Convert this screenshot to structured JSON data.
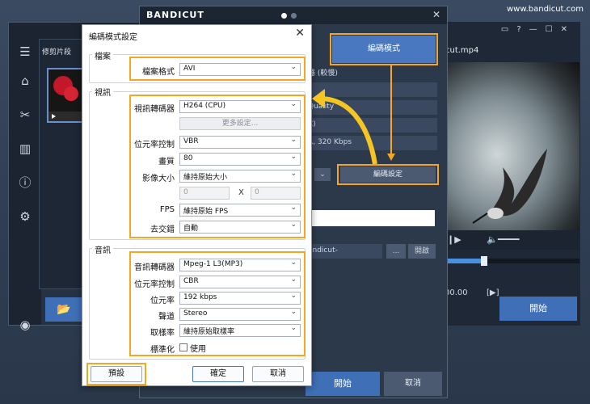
{
  "site": {
    "url": "www.bandicut.com"
  },
  "main_window": {
    "left_panel_header": "修剪片段",
    "open_icon": "folder-icon",
    "sidebar_icons": [
      "menu-icon",
      "home-icon",
      "cut-icon",
      "split-icon",
      "info-icon",
      "gear-icon",
      "record-icon"
    ]
  },
  "preview_window": {
    "filename": "cut.mp4",
    "time": "00.00",
    "frame_label": "[▶]",
    "start_label": "開始"
  },
  "encoding_window": {
    "logo": "BANDICUT",
    "encoding_mode_button": "編碼模式",
    "encoding_settings_button": "編碼設定",
    "rows": [
      "器 (較慢)",
      "Quality",
      "C)",
      "R, 320 Kbps"
    ],
    "output_text": "andicut-",
    "browse_label": "...",
    "open_label": "開啟",
    "start_label": "開始",
    "cancel_label": "取消"
  },
  "dialog": {
    "title": "編碼模式設定",
    "file_group": {
      "label": "檔案",
      "format_label": "檔案格式",
      "format_value": "AVI"
    },
    "video_group": {
      "label": "視訊",
      "codec_label": "視訊轉碼器",
      "codec_value": "H264 (CPU)",
      "more_settings": "更多設定...",
      "bitrate_label": "位元率控制",
      "bitrate_value": "VBR",
      "quality_label": "畫質",
      "quality_value": "80",
      "size_label": "影像大小",
      "size_value": "維持原始大小",
      "width_value": "0",
      "x_sep": "X",
      "height_value": "0",
      "fps_label": "FPS",
      "fps_value": "維持原始 FPS",
      "deinterlace_label": "去交錯",
      "deinterlace_value": "自動"
    },
    "audio_group": {
      "label": "音訊",
      "codec_label": "音訊轉碼器",
      "codec_value": "Mpeg-1 L3(MP3)",
      "bitrate_ctrl_label": "位元率控制",
      "bitrate_ctrl_value": "CBR",
      "bitrate_label": "位元率",
      "bitrate_value": "192 kbps",
      "channel_label": "聲道",
      "channel_value": "Stereo",
      "samplerate_label": "取樣率",
      "samplerate_value": "維持原始取樣率",
      "normalize_label": "標準化",
      "normalize_check_label": "使用"
    },
    "buttons": {
      "preset": "預設",
      "ok": "確定",
      "cancel": "取消"
    }
  },
  "colors": {
    "highlight": "#f5a623",
    "accent_blue": "#4a78c0",
    "dark_bg": "#2c394b"
  }
}
